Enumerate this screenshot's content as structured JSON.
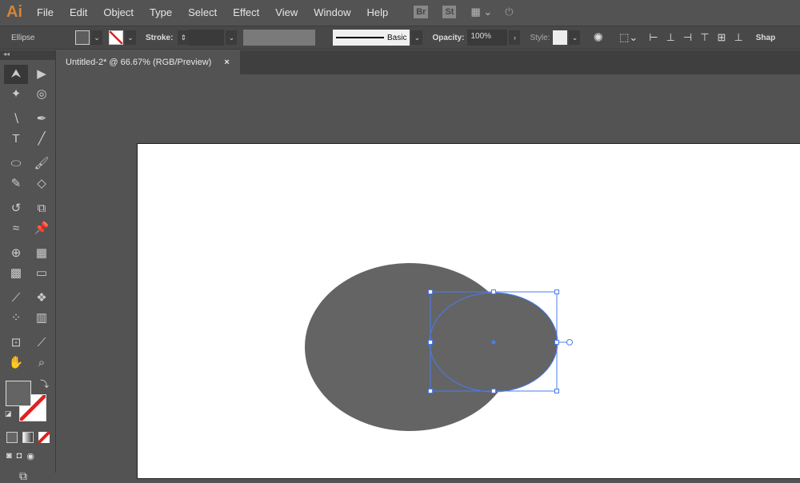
{
  "app": {
    "logo": "Ai",
    "menus": [
      "File",
      "Edit",
      "Object",
      "Type",
      "Select",
      "Effect",
      "View",
      "Window",
      "Help"
    ],
    "bridge": "Br",
    "stock": "St"
  },
  "control": {
    "object_type": "Ellipse",
    "stroke_label": "Stroke:",
    "brush": "Basic",
    "opacity_label": "Opacity:",
    "opacity": "100%",
    "style_label": "Style:",
    "shape_label": "Shap"
  },
  "document": {
    "tab_title": "Untitled-2* @ 66.67% (RGB/Preview)",
    "close": "×"
  },
  "tools": [
    {
      "name": "selection",
      "g": "⮝"
    },
    {
      "name": "direct-selection",
      "g": "▶"
    },
    {
      "name": "magic-wand",
      "g": "✦"
    },
    {
      "name": "lasso",
      "g": "◎"
    },
    {
      "name": "curvature",
      "g": "∖"
    },
    {
      "name": "pen",
      "g": "✒"
    },
    {
      "name": "type",
      "g": "T"
    },
    {
      "name": "line",
      "g": "╱"
    },
    {
      "name": "ellipse",
      "g": "⬭"
    },
    {
      "name": "paintbrush",
      "g": "🖌"
    },
    {
      "name": "shaper",
      "g": "✎"
    },
    {
      "name": "eraser",
      "g": "◇"
    },
    {
      "name": "rotate",
      "g": "↺"
    },
    {
      "name": "scale",
      "g": "⧉"
    },
    {
      "name": "warp",
      "g": "≈"
    },
    {
      "name": "puppet-warp",
      "g": "📌"
    },
    {
      "name": "shape-builder",
      "g": "⊕"
    },
    {
      "name": "perspective-grid",
      "g": "▦"
    },
    {
      "name": "mesh",
      "g": "▩"
    },
    {
      "name": "gradient",
      "g": "▭"
    },
    {
      "name": "eyedropper",
      "g": "⟋"
    },
    {
      "name": "blend",
      "g": "❖"
    },
    {
      "name": "symbol-sprayer",
      "g": "⁘"
    },
    {
      "name": "column-graph",
      "g": "▥"
    },
    {
      "name": "artboard",
      "g": "⊡"
    },
    {
      "name": "slice",
      "g": "⟋"
    },
    {
      "name": "hand",
      "g": "✋"
    },
    {
      "name": "zoom",
      "g": "⌕"
    }
  ],
  "colors": {
    "fill": "#646464",
    "selection": "#4a7cf0",
    "logo": "#d4833a"
  }
}
